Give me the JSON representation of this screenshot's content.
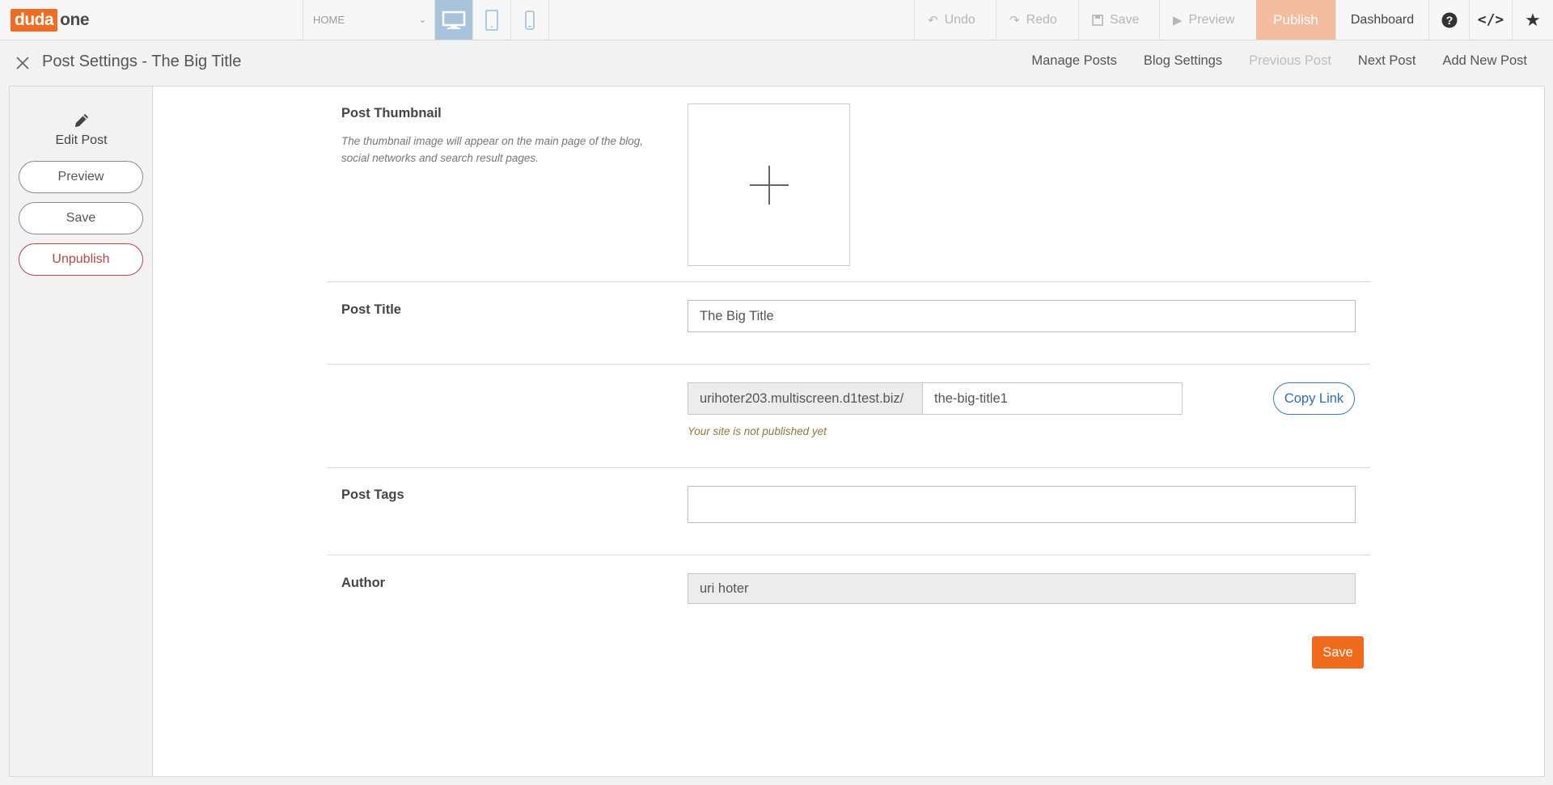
{
  "toolbar": {
    "logo_left": "duda",
    "logo_right": "one",
    "page_select": "HOME",
    "undo": "Undo",
    "redo": "Redo",
    "save": "Save",
    "preview": "Preview",
    "publish": "Publish",
    "dashboard": "Dashboard",
    "accent_color": "#f06c23",
    "publish_color": "#f5bda0",
    "active_device_color": "#a9c3dc"
  },
  "subheader": {
    "title": "Post Settings - The Big Title",
    "nav": [
      "Manage Posts",
      "Blog Settings",
      "Previous Post",
      "Next Post",
      "Add New Post"
    ]
  },
  "sidebar": {
    "edit_post": "Edit Post",
    "preview": "Preview",
    "save": "Save",
    "unpublish": "Unpublish"
  },
  "form": {
    "thumbnail_label": "Post Thumbnail",
    "thumbnail_hint": "The thumbnail image will appear on the main page of the blog, social networks and search result pages.",
    "title_label": "Post Title",
    "title_value": "The Big Title",
    "url_prefix": "urihoter203.multiscreen.d1test.biz/",
    "url_slug": "the-big-title1",
    "url_note": "Your site is not published yet",
    "copy_link": "Copy Link",
    "tags_label": "Post Tags",
    "tags_value": "",
    "author_label": "Author",
    "author_value": "uri hoter",
    "save": "Save",
    "save_color": "#f26a1b"
  }
}
